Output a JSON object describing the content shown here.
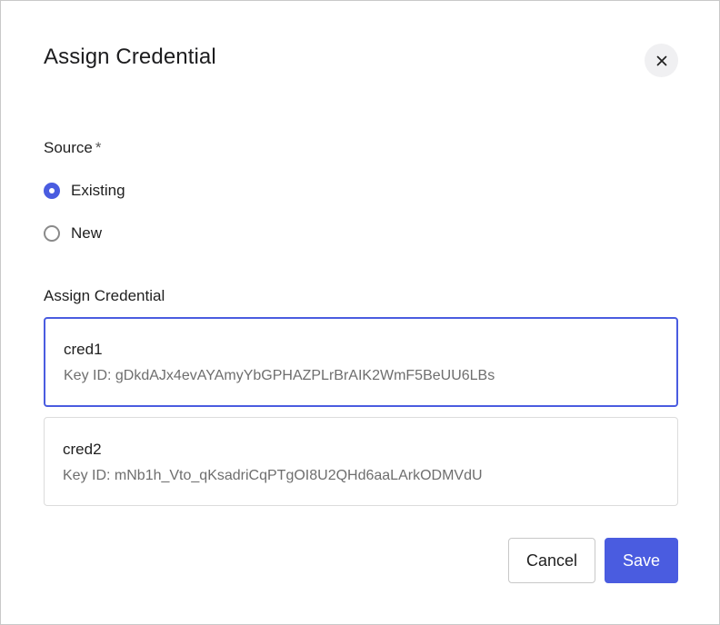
{
  "dialog": {
    "title": "Assign Credential",
    "close_icon": "close-icon"
  },
  "source": {
    "label": "Source",
    "required_mark": "*",
    "options": [
      {
        "label": "Existing",
        "checked": true
      },
      {
        "label": "New",
        "checked": false
      }
    ]
  },
  "credentials": {
    "label": "Assign Credential",
    "items": [
      {
        "name": "cred1",
        "key_id": "Key ID: gDkdAJx4evAYAmyYbGPHAZPLrBrAIK2WmF5BeUU6LBs",
        "selected": true
      },
      {
        "name": "cred2",
        "key_id": "Key ID: mNb1h_Vto_qKsadriCqPTgOI8U2QHd6aaLArkODMVdU",
        "selected": false
      }
    ]
  },
  "footer": {
    "cancel_label": "Cancel",
    "save_label": "Save"
  },
  "colors": {
    "accent": "#4a5ce0",
    "border": "#dcdcdc",
    "muted_text": "#6e6e6e"
  }
}
